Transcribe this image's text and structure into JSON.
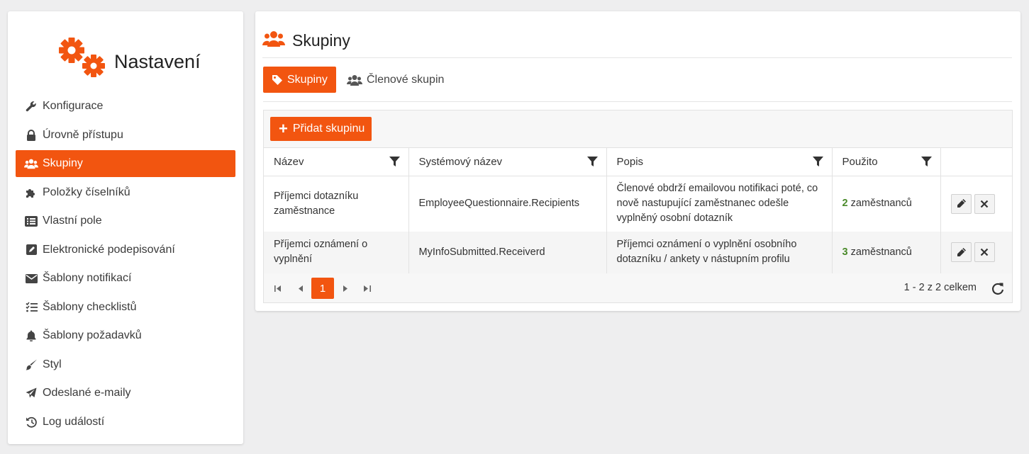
{
  "brand": {
    "title": "Nastavení",
    "icon": "gears-icon",
    "accent": "#f25510"
  },
  "sidebar": {
    "items": [
      {
        "label": "Konfigurace",
        "icon": "wrench-icon",
        "active": false
      },
      {
        "label": "Úrovně přístupu",
        "icon": "lock-icon",
        "active": false
      },
      {
        "label": "Skupiny",
        "icon": "users-icon",
        "active": true
      },
      {
        "label": "Položky číselníků",
        "icon": "puzzle-icon",
        "active": false
      },
      {
        "label": "Vlastní pole",
        "icon": "list-icon",
        "active": false
      },
      {
        "label": "Elektronické podepisování",
        "icon": "signature-icon",
        "active": false
      },
      {
        "label": "Šablony notifikací",
        "icon": "envelope-icon",
        "active": false
      },
      {
        "label": "Šablony checklistů",
        "icon": "checklist-icon",
        "active": false
      },
      {
        "label": "Šablony požadavků",
        "icon": "bell-icon",
        "active": false
      },
      {
        "label": "Styl",
        "icon": "brush-icon",
        "active": false
      },
      {
        "label": "Odeslané e-maily",
        "icon": "paper-plane-icon",
        "active": false
      },
      {
        "label": "Log událostí",
        "icon": "history-icon",
        "active": false
      }
    ]
  },
  "page": {
    "title": "Skupiny",
    "tabs": [
      {
        "label": "Skupiny",
        "icon": "tag-icon",
        "active": true
      },
      {
        "label": "Členové skupin",
        "icon": "users-icon",
        "active": false
      }
    ]
  },
  "grid": {
    "add_label": "Přidat skupinu",
    "columns": [
      "Název",
      "Systémový název",
      "Popis",
      "Použito"
    ],
    "rows": [
      {
        "name": "Příjemci dotazníku zaměstnance",
        "system_name": "EmployeeQuestionnaire.Recipients",
        "description": "Členové obdrží emailovou notifikaci poté, co nově nastupující zaměstnanec odešle vyplněný osobní dotazník",
        "count": "2",
        "count_suffix": " zaměstnanců"
      },
      {
        "name": "Příjemci oznámení o vyplnění",
        "system_name": "MyInfoSubmitted.Receiverd",
        "description": "Příjemci oznámení o vyplnění osobního dotazníku / ankety v nástupním profilu",
        "count": "3",
        "count_suffix": " zaměstnanců"
      }
    ],
    "pager": {
      "current_page": "1",
      "info": "1 - 2 z 2 celkem"
    }
  }
}
